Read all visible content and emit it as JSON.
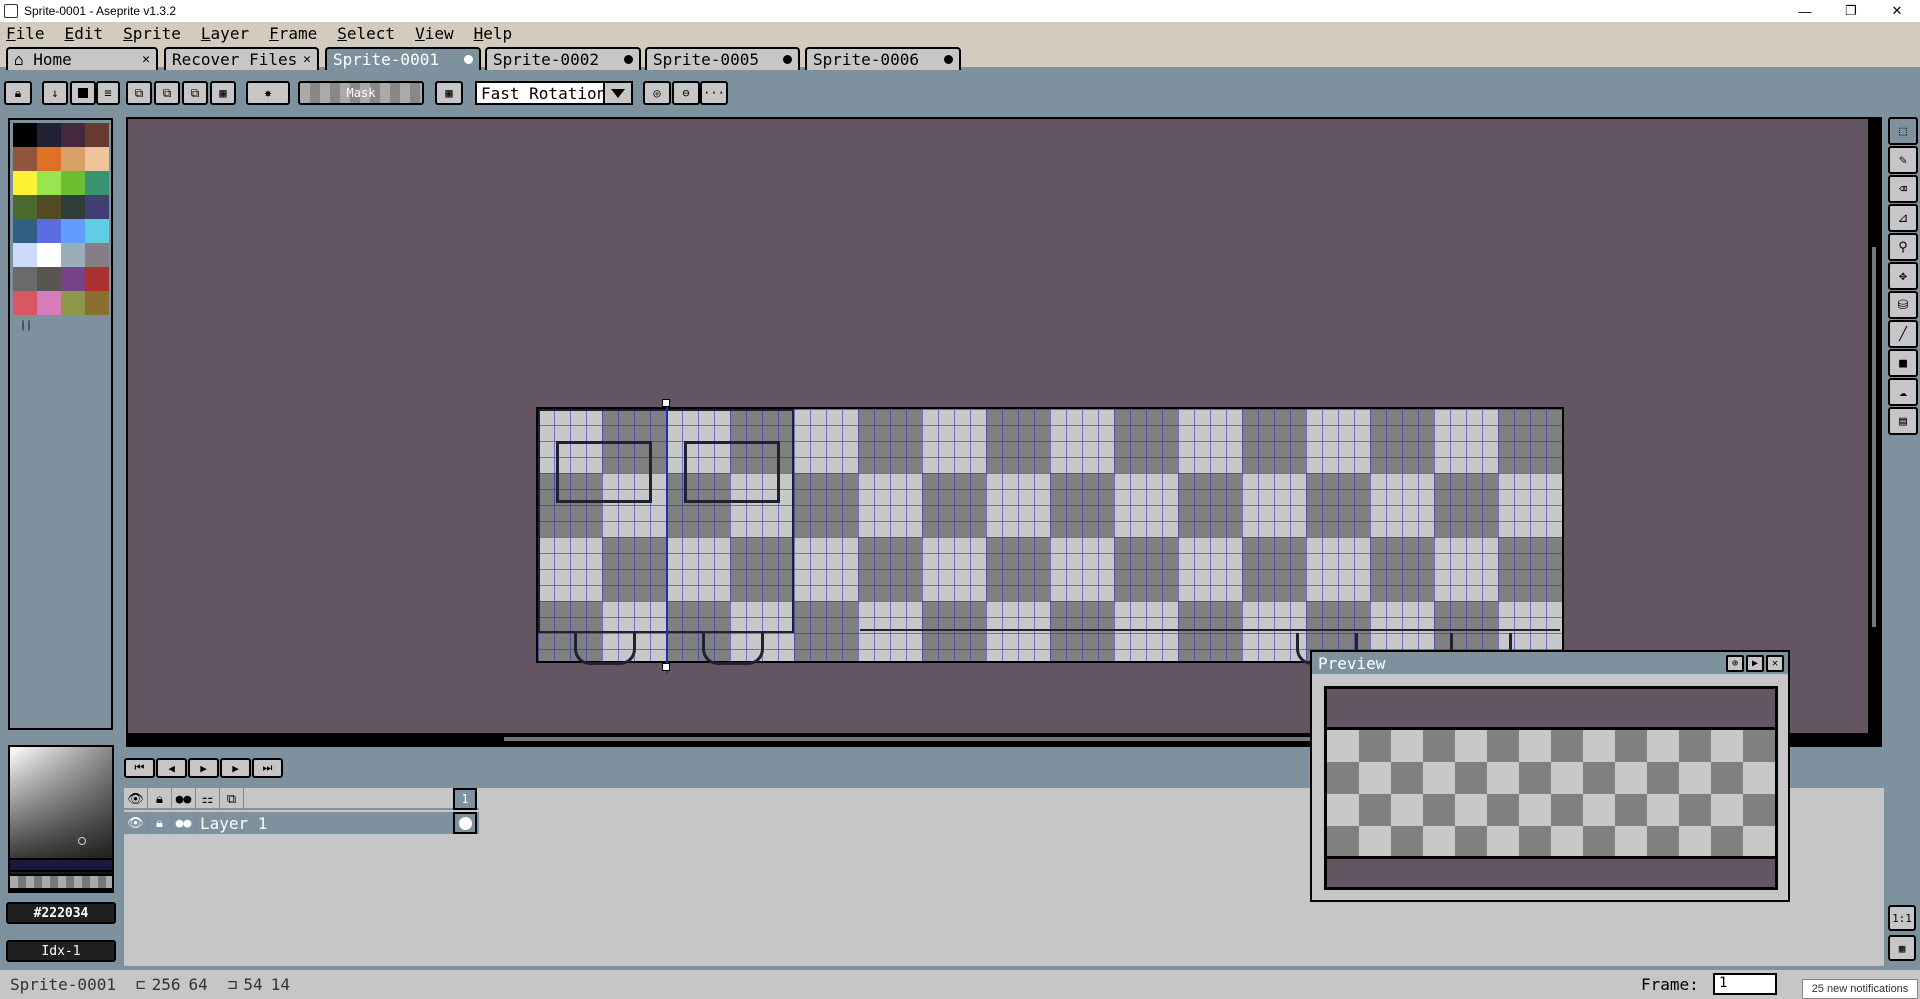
{
  "window": {
    "title": "Sprite-0001 - Aseprite v1.3.2",
    "minimize": "—",
    "maximize": "❐",
    "close": "✕"
  },
  "menu": [
    "File",
    "Edit",
    "Sprite",
    "Layer",
    "Frame",
    "Select",
    "View",
    "Help"
  ],
  "tabs": [
    {
      "label": "Home"
    },
    {
      "label": "Recover Files"
    },
    {
      "label": "Sprite-0001"
    },
    {
      "label": "Sprite-0002"
    },
    {
      "label": "Sprite-0005"
    },
    {
      "label": "Sprite-0006"
    }
  ],
  "toolbar": {
    "mask_label": "Mask",
    "rotation": "Fast Rotation",
    "more": "···"
  },
  "palette": [
    "#000000",
    "#222034",
    "#45283c",
    "#663931",
    "#8f563b",
    "#df7126",
    "#d9a066",
    "#eec39a",
    "#fbf236",
    "#99e550",
    "#6abe30",
    "#37946e",
    "#4b692f",
    "#524b24",
    "#323c39",
    "#3f3f74",
    "#306082",
    "#5b6ee1",
    "#639bff",
    "#5fcde4",
    "#cbdbfc",
    "#ffffff",
    "#9badb7",
    "#847e87",
    "#696a6a",
    "#595652",
    "#76428a",
    "#ac3232",
    "#d95763",
    "#d77bba",
    "#8f974a",
    "#8a6f30"
  ],
  "color": {
    "hex": "#222034",
    "index": "Idx-1"
  },
  "timeline": {
    "frame": "1",
    "layer_name": "Layer 1"
  },
  "preview": {
    "title": "Preview"
  },
  "zoom": {
    "one_to_one": "1:1"
  },
  "status": {
    "sprite": "Sprite-0001",
    "size_w": "256",
    "size_h": "64",
    "pos_x": "54",
    "pos_y": "14",
    "frame_label": "Frame:",
    "frame_value": "1",
    "notifications": "25 new notifications"
  },
  "tools": [
    "marquee-icon",
    "pencil-icon",
    "eraser-icon",
    "eyedropper-icon",
    "zoom-icon",
    "move-icon",
    "fill-icon",
    "line-icon",
    "rectangle-icon",
    "blur-icon",
    "dither-icon"
  ]
}
